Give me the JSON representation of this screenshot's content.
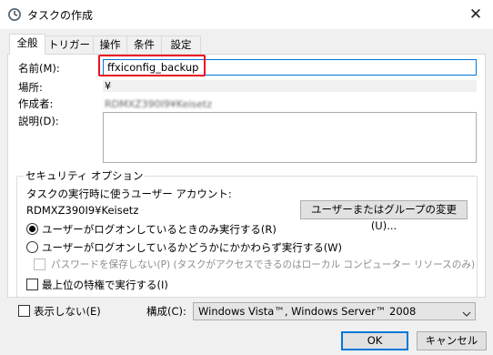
{
  "window": {
    "title": "タスクの作成",
    "close_glyph": "✕"
  },
  "tabs": [
    {
      "label": "全般",
      "active": true
    },
    {
      "label": "トリガー",
      "active": false
    },
    {
      "label": "操作",
      "active": false
    },
    {
      "label": "条件",
      "active": false
    },
    {
      "label": "設定",
      "active": false
    }
  ],
  "general": {
    "name_label": "名前(M):",
    "name_value": "ffxiconfig_backup",
    "location_label": "場所:",
    "location_value": "¥",
    "author_label": "作成者:",
    "author_value": "RDMXZ390I9¥Keisetz",
    "description_label": "説明(D):",
    "description_value": ""
  },
  "security": {
    "group_title": "セキュリティ オプション",
    "account_label": "タスクの実行時に使うユーザー アカウント:",
    "account_value": "RDMXZ390I9¥Keisetz",
    "change_user_button": "ユーザーまたはグループの変更(U)...",
    "radio_logged_on": "ユーザーがログオンしているときのみ実行する(R)",
    "radio_whether": "ユーザーがログオンしているかどうかにかかわらず実行する(W)",
    "no_store_password": "パスワードを保存しない(P) (タスクがアクセスできるのはローカル コンピューター リソースのみ)",
    "highest_privileges": "最上位の特権で実行する(I)",
    "selected_radio": "radio_logged_on"
  },
  "footer": {
    "hidden_label": "表示しない(E)",
    "configure_label": "構成(C):",
    "configure_value": "Windows Vista™, Windows Server™ 2008",
    "ok_button": "OK",
    "cancel_button": "キャンセル"
  },
  "colors": {
    "accent": "#0078d7",
    "highlight_box": "#e81123"
  }
}
